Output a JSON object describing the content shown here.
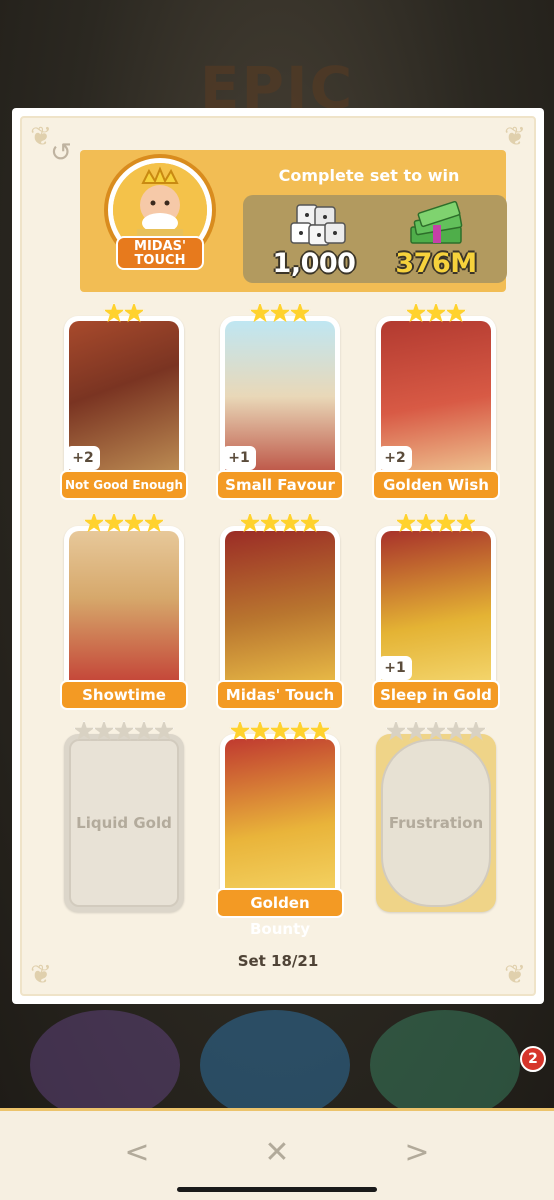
{
  "background": {
    "banner": "EPIC"
  },
  "header": {
    "title": "Complete set to win",
    "set_name": "MIDAS' TOUCH",
    "prizes": [
      {
        "icon": "dice-icon",
        "value": "1,000"
      },
      {
        "icon": "cash-stack-icon",
        "value": "376M"
      }
    ]
  },
  "cards": [
    {
      "name": "Not Good Enough",
      "stars": 2,
      "count": "+2",
      "owned": true
    },
    {
      "name": "Small Favour",
      "stars": 3,
      "count": "+1",
      "owned": true
    },
    {
      "name": "Golden Wish",
      "stars": 3,
      "count": "+2",
      "owned": true
    },
    {
      "name": "Showtime",
      "stars": 4,
      "count": "",
      "owned": true
    },
    {
      "name": "Midas' Touch",
      "stars": 4,
      "count": "",
      "owned": true
    },
    {
      "name": "Sleep in Gold",
      "stars": 4,
      "count": "+1",
      "owned": true
    },
    {
      "name": "Liquid Gold",
      "stars": 5,
      "count": "",
      "owned": false
    },
    {
      "name": "Golden Bounty",
      "stars": 5,
      "count": "",
      "owned": true
    },
    {
      "name": "Frustration",
      "stars": 5,
      "count": "",
      "owned": false
    }
  ],
  "progress": "Set 18/21",
  "navigation": {
    "prev": "<",
    "close": "✕",
    "next": ">"
  },
  "notification_count": "2",
  "colors": {
    "accent": "#f39a24",
    "header": "#f2bd54",
    "panel": "#f8f1e2"
  }
}
